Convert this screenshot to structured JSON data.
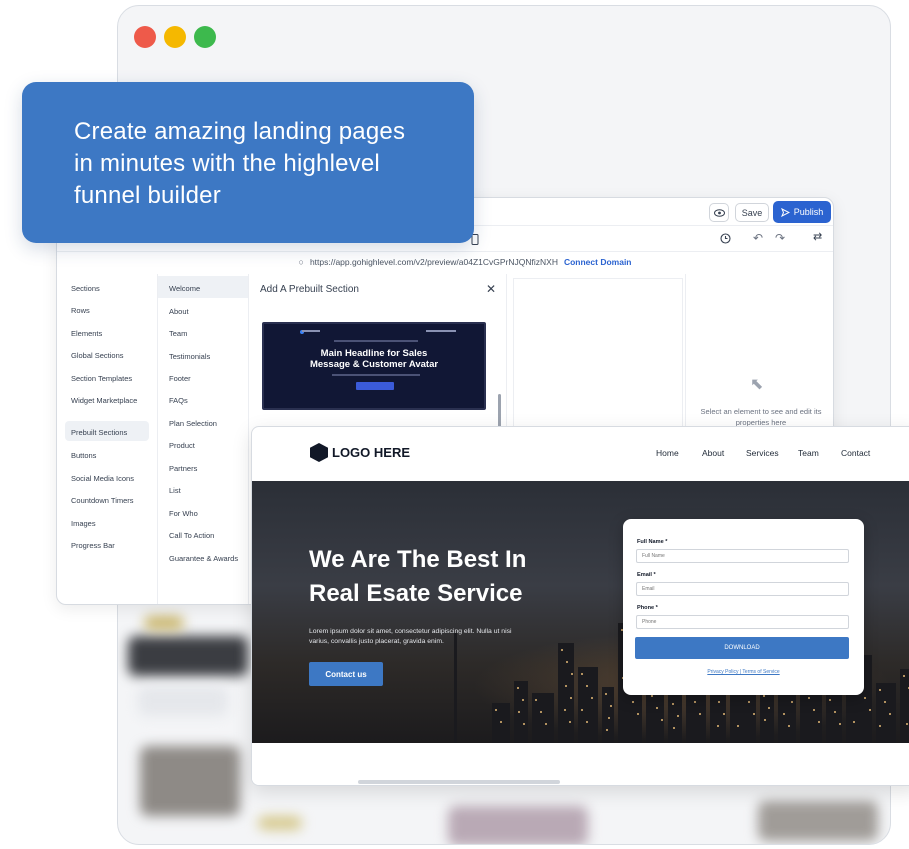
{
  "callout": {
    "line1": "Create amazing landing pages",
    "line2": "in minutes with the highlevel",
    "line3": "funnel builder"
  },
  "editor": {
    "top_buttons": {
      "save": "Save",
      "publish": "Publish"
    },
    "url": "https://app.gohighlevel.com/v2/preview/a04Z1CvGPrNJQNfizNXH",
    "connect_domain": "Connect Domain",
    "left_nav": [
      "Sections",
      "Rows",
      "Elements",
      "Global Sections",
      "Section Templates",
      "Widget Marketplace",
      "Prebuilt Sections",
      "Buttons",
      "Social Media Icons",
      "Countdown Timers",
      "Images",
      "Progress Bar"
    ],
    "left_nav_active": "Prebuilt Sections",
    "mid_nav": [
      "Welcome",
      "About",
      "Team",
      "Testimonials",
      "Footer",
      "FAQs",
      "Plan Selection",
      "Product",
      "Partners",
      "List",
      "For Who",
      "Call To Action",
      "Guarantee & Awards"
    ],
    "mid_nav_active": "Welcome",
    "panel_title": "Add A Prebuilt Section",
    "thumbnail_headline_1": "Main Headline for Sales",
    "thumbnail_headline_2": "Message & Customer Avatar",
    "right_hint": "Select an element to see and edit its properties here"
  },
  "landing": {
    "logo": "LOGO HERE",
    "nav": [
      "Home",
      "About",
      "Services",
      "Team",
      "Contact"
    ],
    "headline_1": "We Are The Best In",
    "headline_2": "Real Esate Service",
    "paragraph": "Lorem ipsum dolor sit amet, consectetur adipiscing elit. Nulla ut nisi varius, convallis justo placerat, gravida enim.",
    "cta": "Contact us",
    "form": {
      "full_name_label": "Full Name *",
      "full_name_placeholder": "Full Name",
      "email_label": "Email *",
      "email_placeholder": "Email",
      "phone_label": "Phone *",
      "phone_placeholder": "Phone",
      "button": "DOWNLOAD",
      "policy": "Privacy Policy | Terms of Service"
    }
  },
  "colors": {
    "accent": "#3d78c4",
    "publish": "#2b63d0",
    "close": "#ee5a4a",
    "minimize": "#f5b800",
    "maximize": "#3db94d"
  }
}
